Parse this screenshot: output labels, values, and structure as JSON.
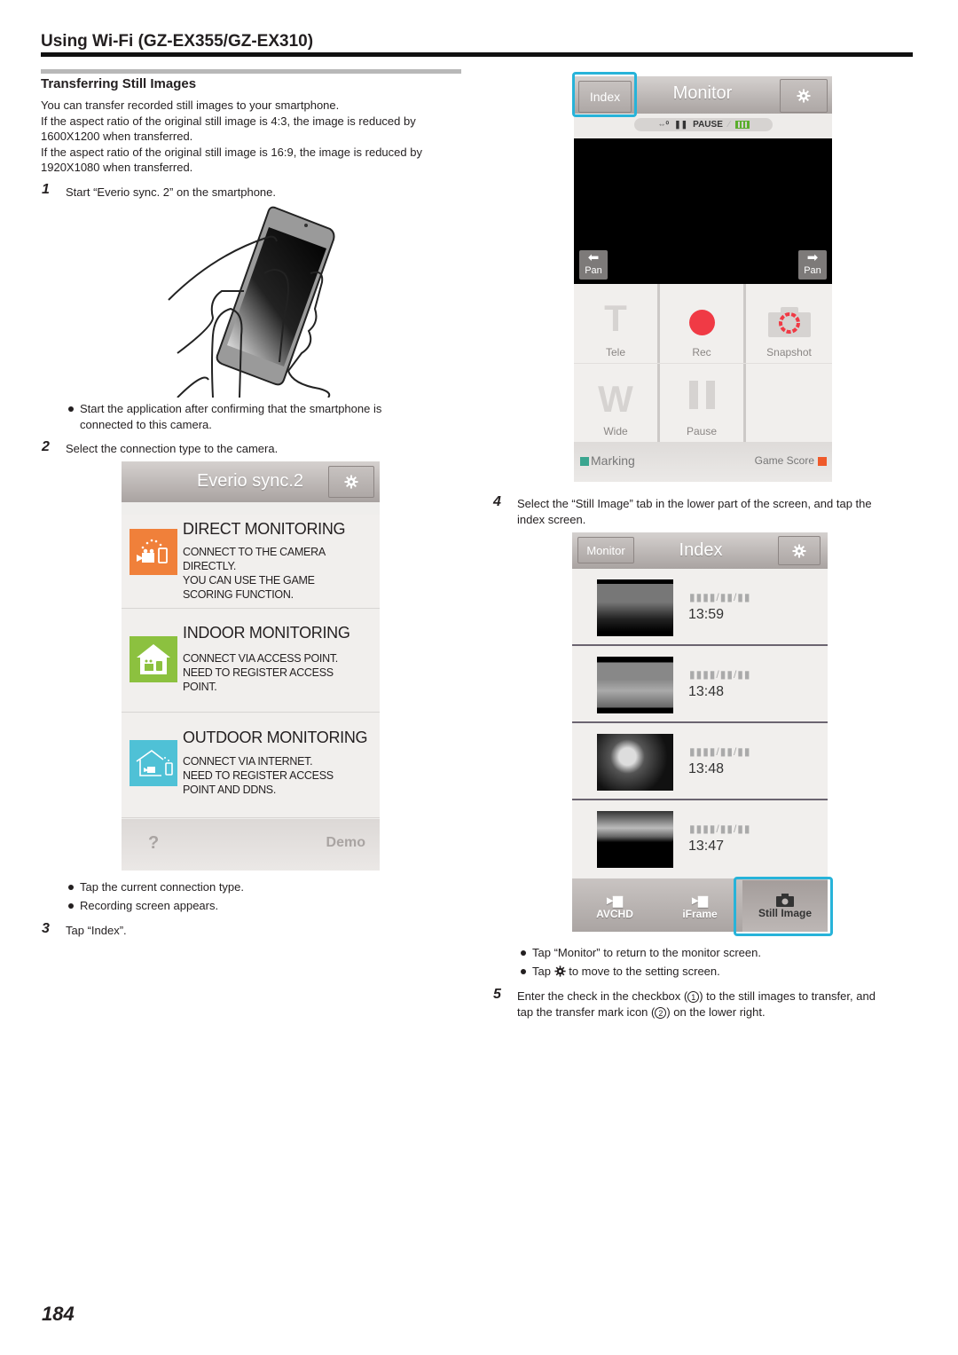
{
  "header": {
    "title": "Using Wi-Fi (GZ-EX355/GZ-EX310)"
  },
  "section": {
    "title": "Transferring Still Images",
    "intro": [
      "You can transfer recorded still images to your smartphone.",
      "If the aspect ratio of the original still image is 4:3, the image is reduced by",
      "1600X1200 when transferred.",
      "If the aspect ratio of the original still image is 16:9, the image is reduced by",
      "1920X1080 when transferred."
    ]
  },
  "steps": [
    {
      "num": "1",
      "text": "Start “Everio sync. 2” on the smartphone.",
      "bullets": [
        "Start the application after confirming that the smartphone is",
        "connected to this camera."
      ]
    },
    {
      "num": "2",
      "text": "Select the connection type to the camera.",
      "bullets": [
        "Tap the current connection type.",
        "Recording screen appears."
      ]
    },
    {
      "num": "3",
      "text": "Tap “Index”."
    },
    {
      "num": "4",
      "text_lines": [
        "Select the “Still Image” tab in the lower part of the screen, and tap the",
        "index screen."
      ],
      "bullets": [
        "Tap “Monitor” to return to the monitor screen.",
        "Tap",
        "to move to the setting screen."
      ]
    },
    {
      "num": "5",
      "text_lines": [
        "Enter the check in the checkbox (",
        ") to the still images to transfer, and",
        "tap the transfer mark icon (",
        ") on the lower right."
      ],
      "marks": [
        "1",
        "2"
      ]
    }
  ],
  "everio_screen": {
    "title": "Everio sync.2",
    "options": [
      {
        "heading": "DIRECT MONITORING",
        "lines": [
          "CONNECT TO THE CAMERA",
          "DIRECTLY.",
          "YOU CAN USE THE GAME",
          "SCORING FUNCTION."
        ],
        "icon": "camera-phone-icon",
        "color": "#f0803a"
      },
      {
        "heading": "INDOOR MONITORING",
        "lines": [
          "CONNECT VIA ACCESS POINT.",
          "NEED TO REGISTER ACCESS",
          "POINT."
        ],
        "icon": "house-icon",
        "color": "#8cc13f"
      },
      {
        "heading": "OUTDOOR MONITORING",
        "lines": [
          "CONNECT VIA INTERNET.",
          "NEED TO REGISTER ACCESS",
          "POINT AND DDNS."
        ],
        "icon": "house-outline-icon",
        "color": "#4fc1d6"
      }
    ],
    "help": "?",
    "demo": "Demo"
  },
  "monitor_screen": {
    "title": "Monitor",
    "index_button": "Index",
    "status": "PAUSE",
    "pan_left": "Pan",
    "pan_right": "Pan",
    "tele_glyph": "T",
    "tele": "Tele",
    "rec": "Rec",
    "snapshot": "Snapshot",
    "wide_glyph": "W",
    "wide": "Wide",
    "pause": "Pause",
    "marking": "Marking",
    "game_score": "Game Score",
    "colors": {
      "marking": "#3aa58f",
      "game_score": "#ef5a2a",
      "rec": "#f03a45",
      "highlight": "#27b3d9"
    }
  },
  "index_screen": {
    "title": "Index",
    "monitor_button": "Monitor",
    "items": [
      {
        "date": "▮▮▮▮/▮▮/▮▮",
        "time": "13:59"
      },
      {
        "date": "▮▮▮▮/▮▮/▮▮",
        "time": "13:48"
      },
      {
        "date": "▮▮▮▮/▮▮/▮▮",
        "time": "13:48"
      },
      {
        "date": "▮▮▮▮/▮▮/▮▮",
        "time": "13:47"
      }
    ],
    "tabs": [
      "AVCHD",
      "iFrame",
      "Still Image"
    ],
    "selected_tab": "Still Image"
  },
  "footer": {
    "page_number": "184"
  }
}
